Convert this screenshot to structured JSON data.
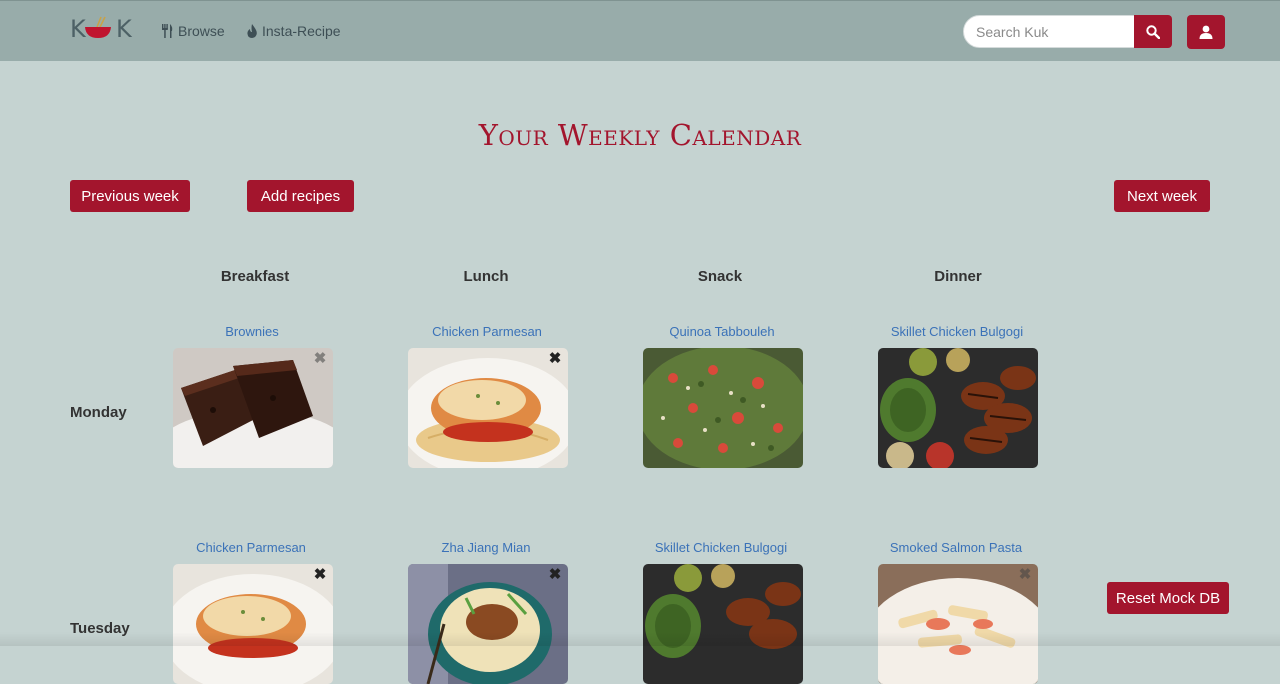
{
  "brand": {
    "logo_text_left": "K",
    "logo_text_right": "K",
    "icon": "bowl-chopsticks-logo-icon"
  },
  "nav": {
    "browse_label": "Browse",
    "browse_icon": "fork-knife-icon",
    "insta_label": "Insta-Recipe",
    "insta_icon": "flame-icon"
  },
  "search": {
    "placeholder": "Search Kuk",
    "icon": "search-icon"
  },
  "user": {
    "icon": "user-icon"
  },
  "page": {
    "title": "Your Weekly Calendar"
  },
  "buttons": {
    "previous_week": "Previous week",
    "add_recipes": "Add recipes",
    "next_week": "Next week",
    "reset_mock_db": "Reset Mock DB"
  },
  "columns": [
    "Breakfast",
    "Lunch",
    "Snack",
    "Dinner"
  ],
  "days": [
    {
      "name": "Monday",
      "meals": [
        {
          "name": "Brownies",
          "remove": true,
          "remove_faint": true
        },
        {
          "name": "Chicken Parmesan",
          "remove": true
        },
        {
          "name": "Quinoa Tabbouleh",
          "remove": false
        },
        {
          "name": "Skillet Chicken Bulgogi",
          "remove": false
        }
      ]
    },
    {
      "name": "Tuesday",
      "meals": [
        {
          "name": "Chicken Parmesan",
          "remove": true
        },
        {
          "name": "Zha Jiang Mian",
          "remove": true
        },
        {
          "name": "Skillet Chicken Bulgogi",
          "remove": false
        },
        {
          "name": "Smoked Salmon Pasta",
          "remove": true,
          "remove_faint": true
        }
      ]
    }
  ],
  "colors": {
    "accent": "#a3152d",
    "navbar": "#98acaa",
    "background": "#c5d3d1",
    "link": "#3b72b8"
  }
}
